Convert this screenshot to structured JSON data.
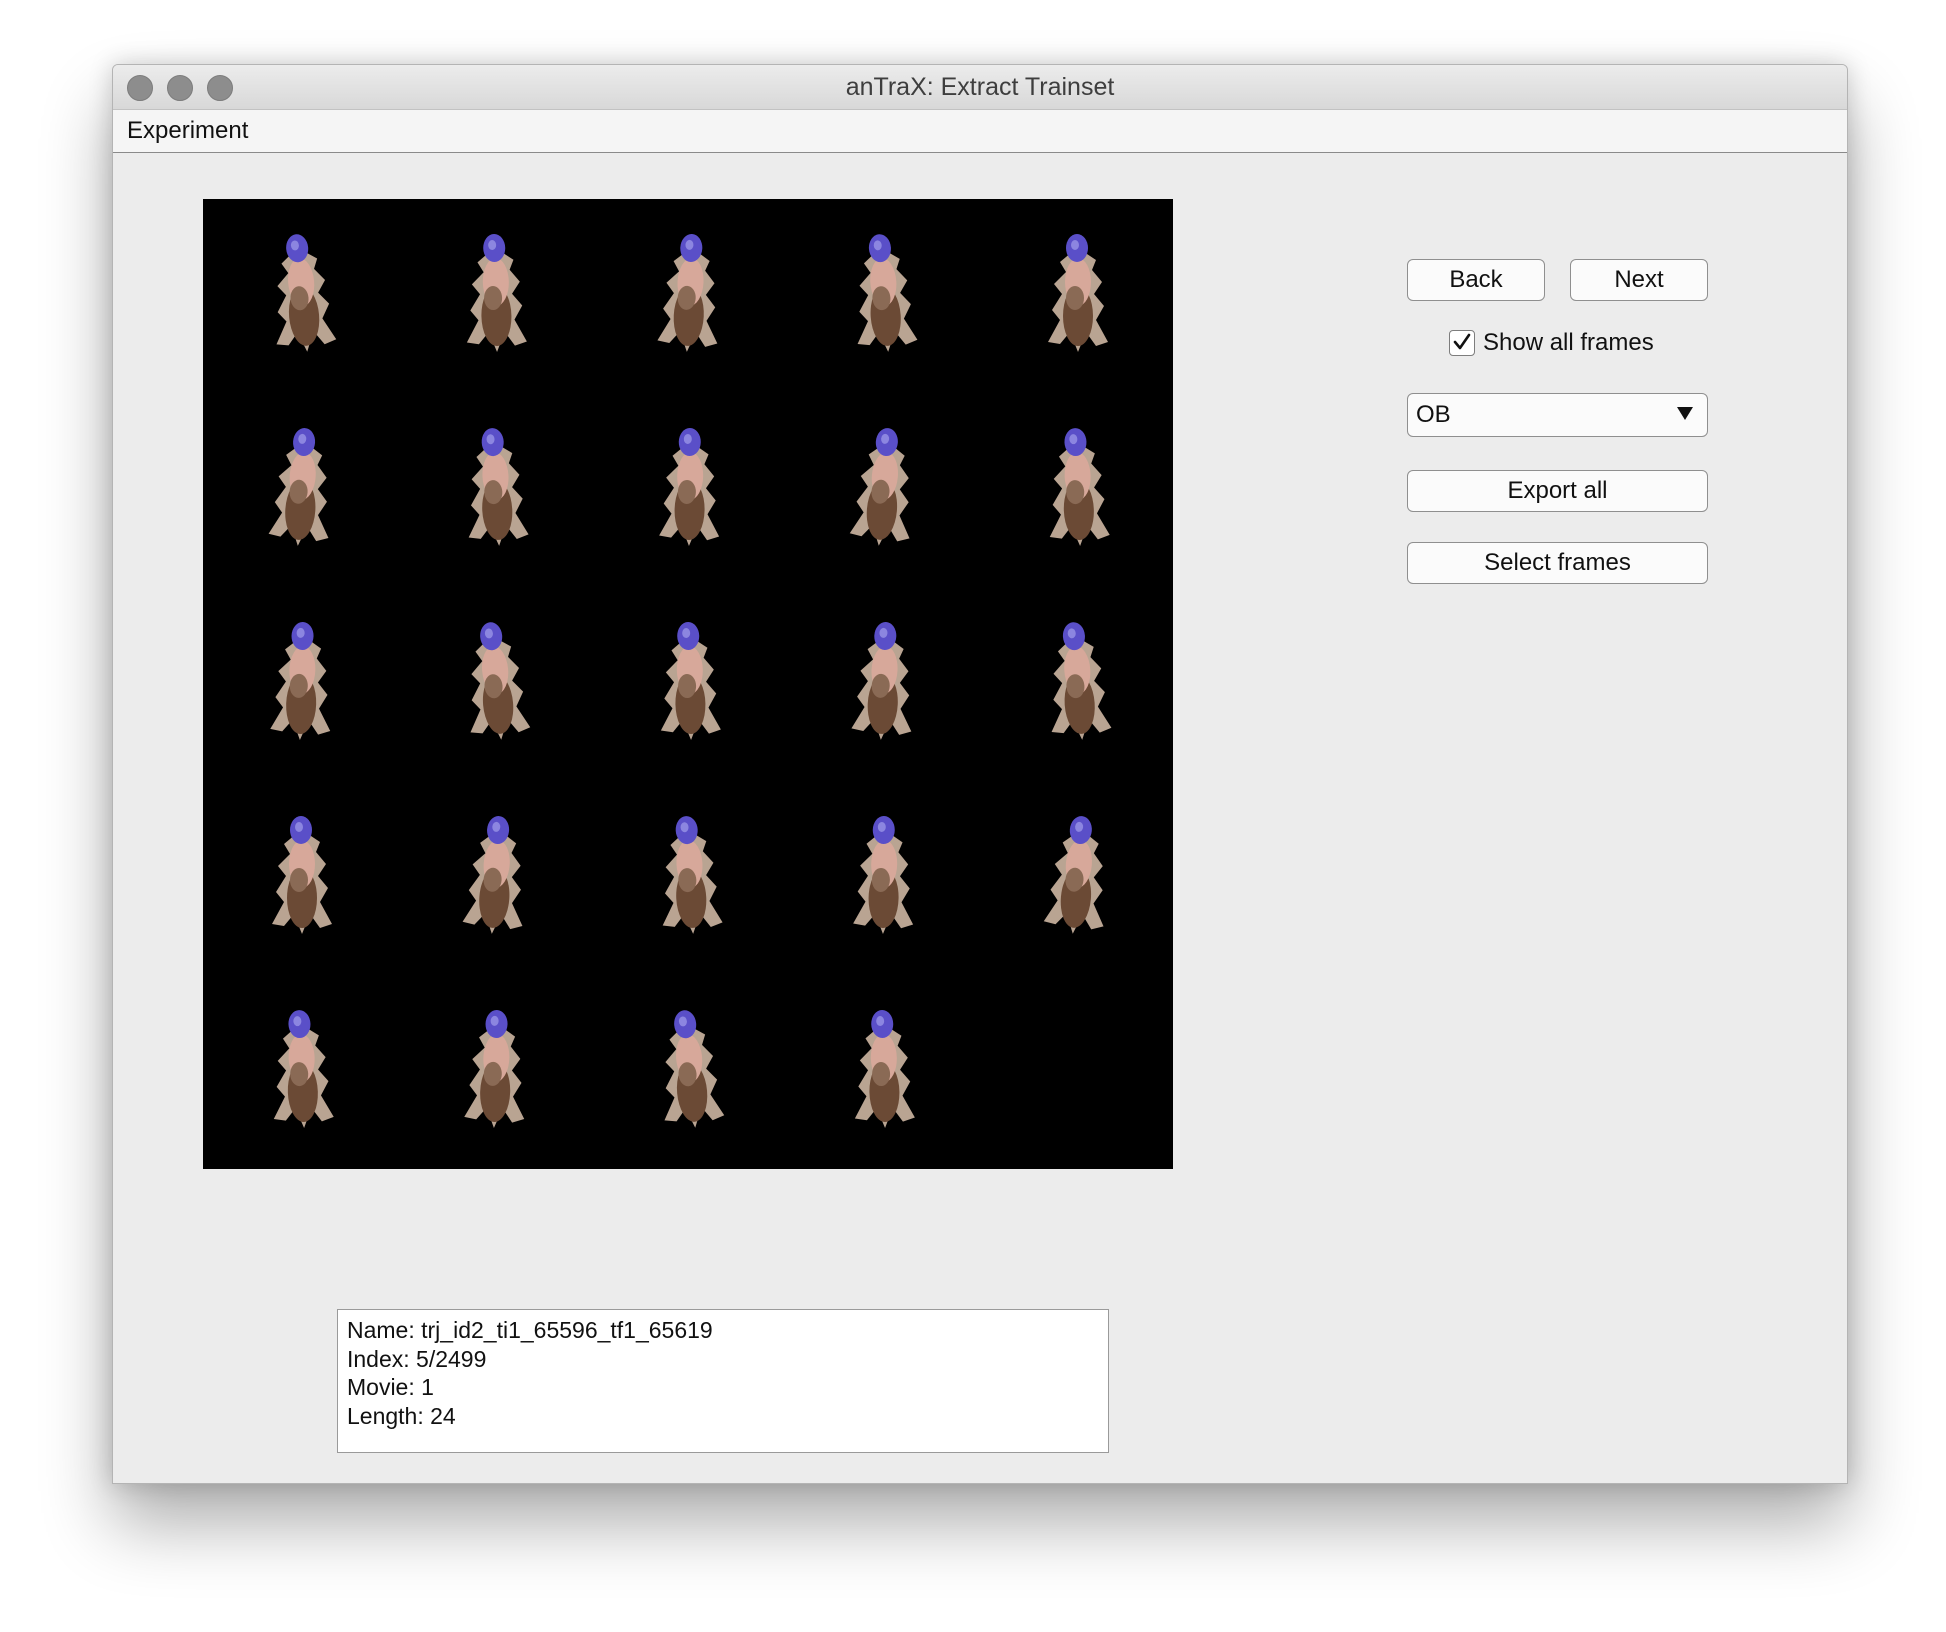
{
  "window": {
    "title": "anTraX: Extract Trainset"
  },
  "menu": {
    "items": [
      "Experiment"
    ]
  },
  "controls": {
    "back_label": "Back",
    "next_label": "Next",
    "show_all_frames_label": "Show all frames",
    "show_all_frames_checked": true,
    "label_dropdown_value": "OB",
    "export_all_label": "Export all",
    "select_frames_label": "Select frames"
  },
  "frames_grid": {
    "rows": 5,
    "columns": 5,
    "frame_count": 24
  },
  "info": {
    "lines": [
      "Name: trj_id2_ti1_65596_tf1_65619",
      "Index: 5/2499",
      "Movie: 1",
      "Length: 24"
    ]
  },
  "colors": {
    "window_bg": "#ececec",
    "axes_bg": "#000000",
    "ant_head": "#5a4fc8"
  }
}
